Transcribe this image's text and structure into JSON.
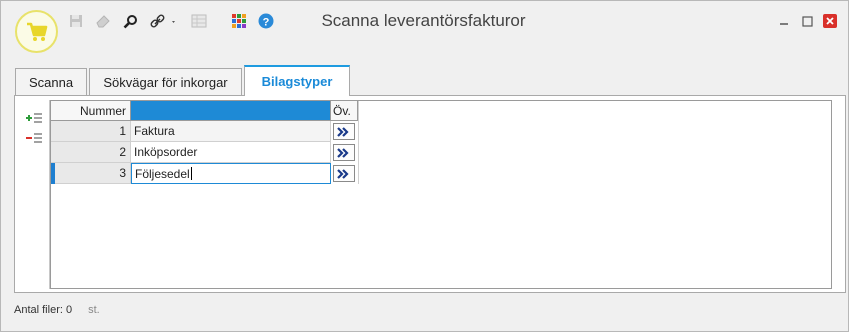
{
  "window": {
    "title": "Scanna leverantörsfakturor"
  },
  "tabs": [
    {
      "label": "Scanna",
      "active": false
    },
    {
      "label": "Sökvägar för inkorgar",
      "active": false
    },
    {
      "label": "Bilagstyper",
      "active": true
    }
  ],
  "grid": {
    "columns": [
      "Nummer",
      "",
      "Öv."
    ],
    "rows": [
      {
        "number": "1",
        "name": "Faktura"
      },
      {
        "number": "2",
        "name": "Inköpsorder"
      },
      {
        "number": "3",
        "name": "Följesedel"
      }
    ]
  },
  "status": {
    "label": "Antal filer: 0",
    "unit": "st."
  },
  "colors": {
    "accent": "#1e9be0",
    "header_selected": "#1e8ad6",
    "app_icon": "#e8d62a"
  },
  "icons": [
    "cart-icon",
    "save-icon",
    "eraser-icon",
    "search-icon",
    "link-icon",
    "grid-icon",
    "palette-icon",
    "help-icon",
    "minimize-icon",
    "maximize-icon",
    "close-icon",
    "add-row-icon",
    "remove-row-icon",
    "forward-icon"
  ]
}
